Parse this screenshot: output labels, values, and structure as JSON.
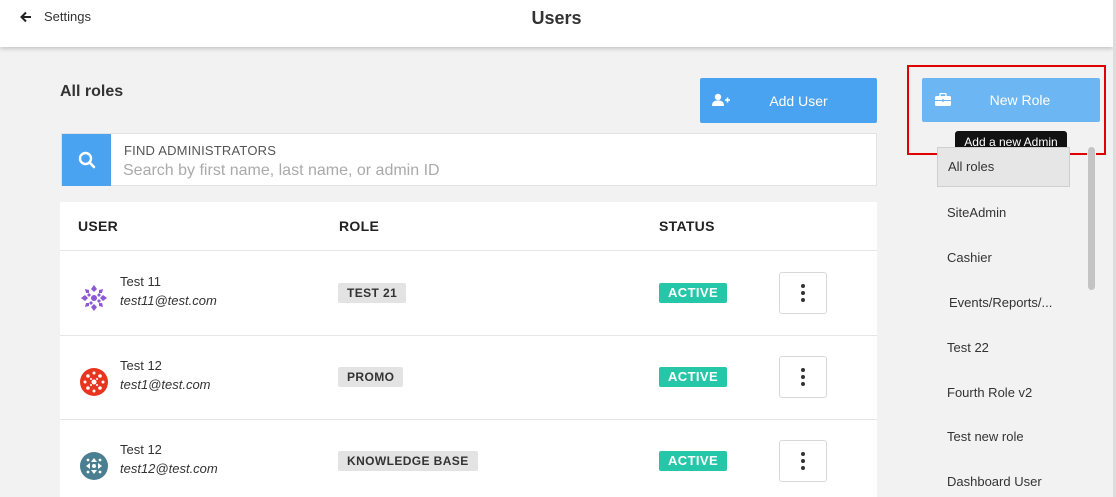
{
  "header": {
    "back_label": "Settings",
    "title": "Users"
  },
  "main": {
    "section_title": "All roles",
    "add_user_label": "Add User",
    "search": {
      "label": "FIND ADMINISTRATORS",
      "placeholder": "Search by first name, last name, or admin ID",
      "value": ""
    },
    "table": {
      "columns": [
        "USER",
        "ROLE",
        "STATUS"
      ],
      "rows": [
        {
          "name": "Test 11",
          "email": "test11@test.com",
          "role": "TEST 21",
          "status": "ACTIVE",
          "avatar_color": "#8e57d6",
          "avatar": "purple-pattern-avatar-icon"
        },
        {
          "name": "Test 12",
          "email": "test1@test.com",
          "role": "PROMO",
          "status": "ACTIVE",
          "avatar_color": "#e8351f",
          "avatar": "red-pattern-avatar-icon"
        },
        {
          "name": "Test 12",
          "email": "test12@test.com",
          "role": "KNOWLEDGE BASE",
          "status": "ACTIVE",
          "avatar_color": "#4a7f91",
          "avatar": "teal-pattern-avatar-icon"
        }
      ]
    }
  },
  "sidebar": {
    "new_role_label": "New Role",
    "tooltip": "Add a new Admin",
    "roles": [
      "All roles",
      "SiteAdmin",
      "Cashier",
      "Events/Reports/...",
      "Test 22",
      "Fourth Role v2",
      "Test new role",
      "Dashboard User"
    ],
    "active_index": 0
  },
  "colors": {
    "primary": "#4aa3f0",
    "primary_light": "#6cb6f4",
    "active_status": "#26c6a8",
    "highlight_border": "#e00000"
  }
}
